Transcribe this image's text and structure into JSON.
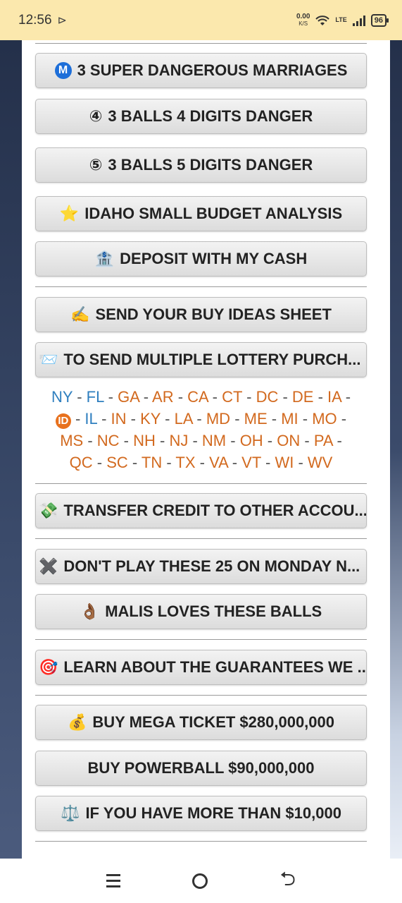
{
  "status": {
    "time": "12:56",
    "net_speed": "0.00",
    "net_unit": "K/S",
    "lte": "LTE",
    "battery": "96"
  },
  "buttons": [
    {
      "icon": "M",
      "label": "3 SUPER DANGEROUS MARRIAGES"
    },
    {
      "icon": "④",
      "label": "3 BALLS 4 DIGITS DANGER"
    },
    {
      "icon": "⑤",
      "label": "3 BALLS 5 DIGITS DANGER"
    },
    {
      "icon": "⭐",
      "label": "IDAHO SMALL BUDGET ANALYSIS"
    },
    {
      "icon": "🏦",
      "label": "DEPOSIT WITH MY CASH"
    },
    {
      "icon": "✍️",
      "label": "SEND YOUR BUY IDEAS SHEET"
    },
    {
      "icon": "📨",
      "label": "TO SEND MULTIPLE LOTTERY PURCH..."
    },
    {
      "icon": "💸",
      "label": "TRANSFER CREDIT TO OTHER ACCOU..."
    },
    {
      "icon": "✖️",
      "label": "DON'T PLAY THESE 25 ON MONDAY N..."
    },
    {
      "icon": "👌🏾",
      "label": "MALIS LOVES THESE BALLS"
    },
    {
      "icon": "🎯",
      "label": "LEARN ABOUT THE GUARANTEES WE ..."
    },
    {
      "icon": "💰",
      "label": "BUY MEGA TICKET $280,000,000"
    },
    {
      "icon": "",
      "label": "BUY POWERBALL $90,000,000"
    },
    {
      "icon": "⚖️",
      "label": "IF YOU HAVE MORE THAN $10,000"
    }
  ],
  "states": {
    "row1": [
      "NY",
      "FL",
      "GA",
      "AR",
      "CA",
      "CT",
      "DC",
      "DE",
      "IA"
    ],
    "row2_badge": "ID",
    "row2": [
      "IL",
      "IN",
      "KY",
      "LA",
      "MD",
      "ME",
      "MI",
      "MO"
    ],
    "row3": [
      "MS",
      "NC",
      "NH",
      "NJ",
      "NM",
      "OH",
      "ON",
      "PA"
    ],
    "row4": [
      "QC",
      "SC",
      "TN",
      "TX",
      "VA",
      "VT",
      "WI",
      "WV"
    ],
    "separator": " - "
  },
  "colors": {
    "status_bar": "#fbe8ad",
    "state_link": "#d2691e",
    "state_link_active": "#2f7fbf",
    "metro_badge": "#1e6fd9"
  }
}
